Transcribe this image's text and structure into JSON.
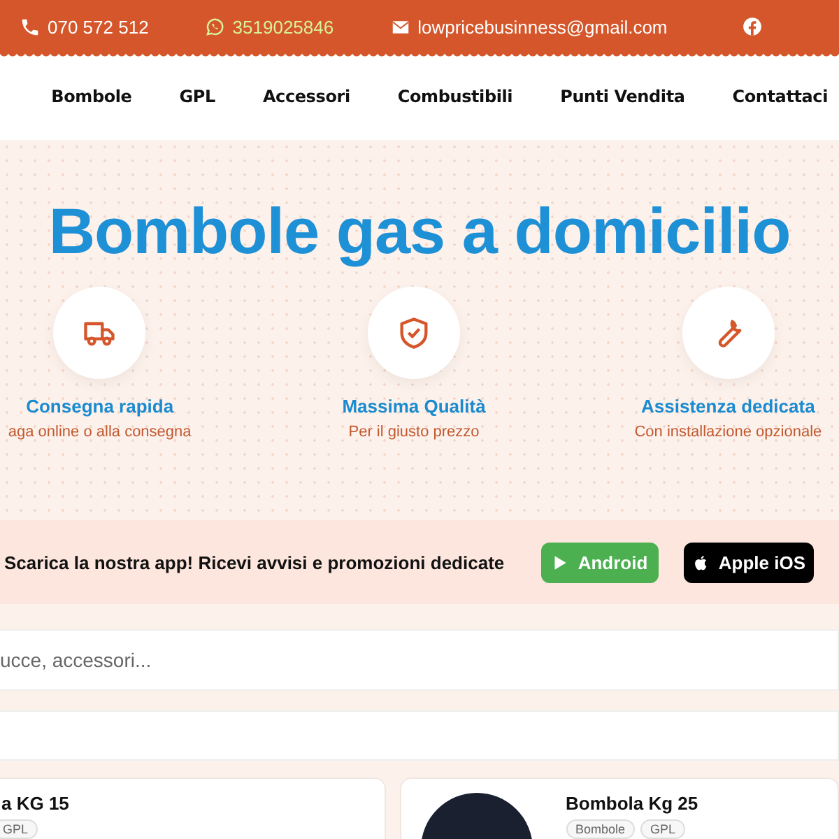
{
  "top_bar": {
    "contacts": [
      {
        "kind": "phone",
        "text": "070 572 512"
      },
      {
        "kind": "whatsapp",
        "text": "3519025846"
      },
      {
        "kind": "email",
        "text": "lowpricebusinness@gmail.com"
      }
    ]
  },
  "nav": {
    "items": [
      "Bombole",
      "GPL",
      "Accessori",
      "Combustibili",
      "Punti Vendita",
      "Contattaci"
    ]
  },
  "hero": {
    "title": "Bombole gas a domicilio",
    "features": [
      {
        "kind": "truck",
        "title": "Consegna rapida",
        "subtitle": "aga online o alla consegna"
      },
      {
        "kind": "shield",
        "title": "Massima Qualità",
        "subtitle": "Per il giusto prezzo"
      },
      {
        "kind": "wrench",
        "title": "Assistenza dedicata",
        "subtitle": "Con installazione opzionale"
      }
    ]
  },
  "app_banner": {
    "text": "Scarica la nostra app! Ricevi avvisi e promozioni dedicate",
    "buttons": [
      {
        "kind": "android",
        "label": "Android"
      },
      {
        "kind": "ios",
        "label": "Apple iOS"
      }
    ]
  },
  "search": {
    "placeholder": "ucce, accessori..."
  },
  "products": [
    {
      "title": "a KG 15",
      "photo": false,
      "tags": [
        "GPL"
      ]
    },
    {
      "title": "Bombola Kg 25",
      "photo": true,
      "tags": [
        "Bombole",
        "GPL"
      ]
    }
  ]
}
